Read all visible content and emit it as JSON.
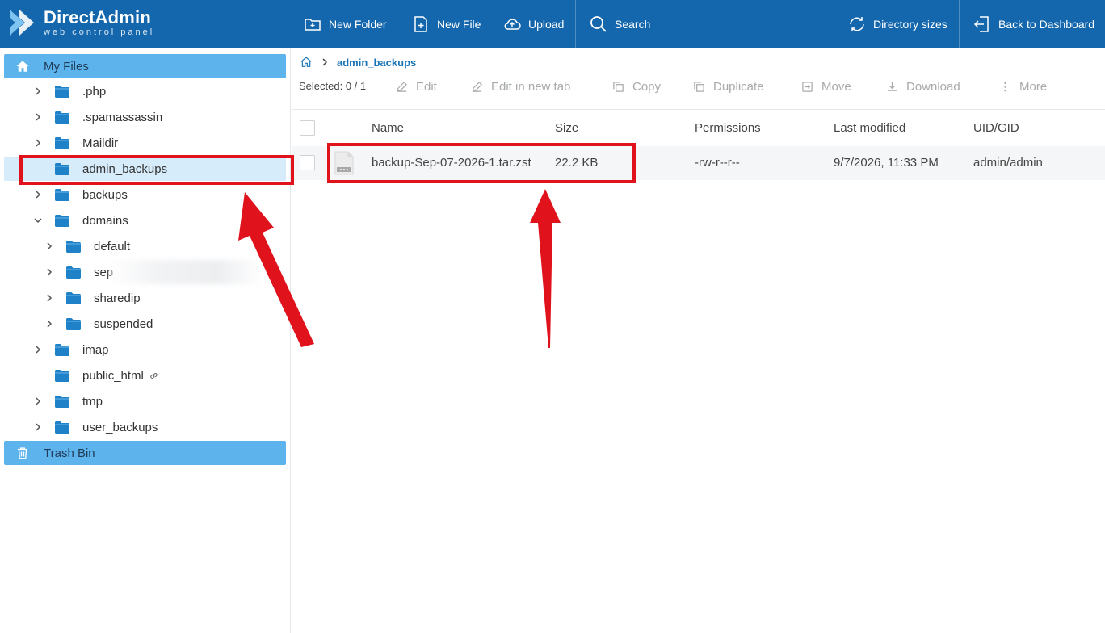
{
  "app": {
    "logo_title": "DirectAdmin",
    "logo_subtitle": "web control panel"
  },
  "toolbar": {
    "new_folder": "New Folder",
    "new_file": "New File",
    "upload": "Upload",
    "search": "Search",
    "directory_sizes": "Directory sizes",
    "back_to_dashboard": "Back to Dashboard"
  },
  "sidebar": {
    "my_files": "My Files",
    "trash_bin": "Trash Bin",
    "items": [
      {
        "label": ".php",
        "expandable": true
      },
      {
        "label": ".spamassassin",
        "expandable": true
      },
      {
        "label": "Maildir",
        "expandable": true
      },
      {
        "label": "admin_backups",
        "expandable": false,
        "selected": true
      },
      {
        "label": "backups",
        "expandable": true
      },
      {
        "label": "domains",
        "expandable": true,
        "expanded": true
      },
      {
        "label": "default",
        "expandable": true
      },
      {
        "label": "sep",
        "expandable": true
      },
      {
        "label": "sharedip",
        "expandable": true
      },
      {
        "label": "suspended",
        "expandable": true
      },
      {
        "label": "imap",
        "expandable": true
      },
      {
        "label": "public_html",
        "expandable": false,
        "symlink": true
      },
      {
        "label": "tmp",
        "expandable": true
      },
      {
        "label": "user_backups",
        "expandable": true
      }
    ]
  },
  "breadcrumb": {
    "current": "admin_backups"
  },
  "actions": {
    "selected_label": "Selected: 0 / 1",
    "edit": "Edit",
    "edit_new_tab": "Edit in new tab",
    "copy": "Copy",
    "duplicate": "Duplicate",
    "move": "Move",
    "download": "Download",
    "more": "More"
  },
  "table": {
    "columns": [
      "Name",
      "Size",
      "Permissions",
      "Last modified",
      "UID/GID"
    ],
    "rows": [
      {
        "name": "backup-Sep-07-2026-1.tar.zst",
        "size": "22.2 KB",
        "permissions": "-rw-r--r--",
        "modified": "9/7/2026, 11:33 PM",
        "owner": "admin/admin"
      }
    ]
  },
  "colors": {
    "topbar": "#1467ad",
    "sidebar_header": "#5db3ec",
    "selected_row": "#d6ecfb",
    "annotation": "#e0131d"
  }
}
